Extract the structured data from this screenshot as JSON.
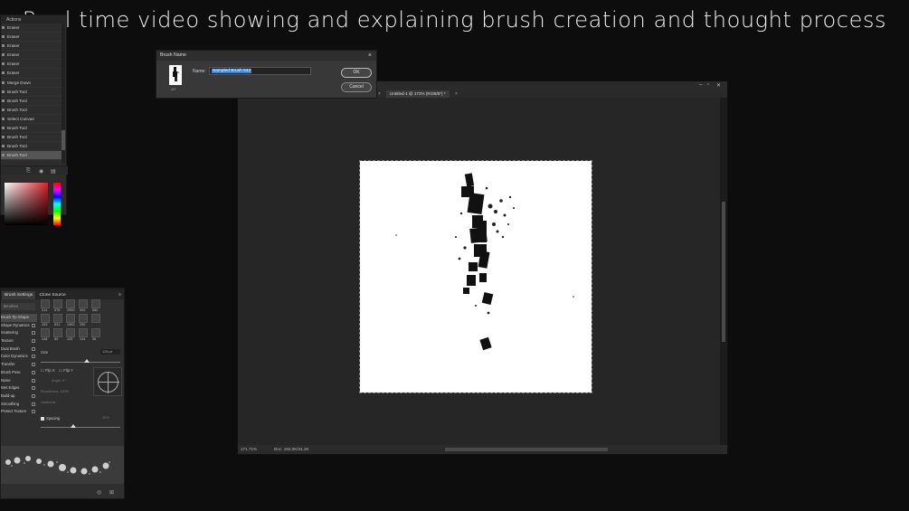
{
  "caption": "Real time video showing and explaining brush creation and thought process",
  "history": {
    "tab_label": "Actions",
    "items": [
      "Eraser",
      "Eraser",
      "Eraser",
      "Eraser",
      "Eraser",
      "Eraser",
      "Merge Down",
      "Brush Tool",
      "Brush Tool",
      "Brush Tool",
      "Select Canvas",
      "Brush Tool",
      "Brush Tool",
      "Brush Tool",
      "Brush Tool"
    ],
    "active_index": 14
  },
  "brush_settings": {
    "tabs": [
      "Brush Settings",
      "Clone Source"
    ],
    "brushes_button": "Brushes",
    "options": [
      "Brush Tip Shape",
      "Shape Dynamics",
      "Scattering",
      "Texture",
      "Dual Brush",
      "Color Dynamics",
      "Transfer",
      "Brush Pose",
      "Noise",
      "Wet Edges",
      "Build-up",
      "Smoothing",
      "Protect Texture"
    ],
    "active_option": 0,
    "tip_numbers_row1": [
      "314",
      "578",
      "2990",
      "900",
      "560"
    ],
    "tip_numbers_row2": [
      "433",
      "831",
      "1983",
      "250",
      ""
    ],
    "tip_numbers_row3": [
      "448",
      "80",
      "125",
      "134",
      "56"
    ],
    "size_label": "Size",
    "size_value": "125 px",
    "flip_x": "Flip X",
    "flip_y": "Flip Y",
    "angle_label": "Angle:",
    "angle_value": "0°",
    "roundness_label": "Roundness:",
    "roundness_value": "100%",
    "hardness_label": "Hardness",
    "spacing_label": "Spacing",
    "spacing_value": "25%"
  },
  "dialog": {
    "title": "Brush Name",
    "name_label": "Name:",
    "name_value": "Sampled Brush 532",
    "ok_label": "OK",
    "cancel_label": "Cancel",
    "thumb_number": "427"
  },
  "document": {
    "tab_title": "Untitled-1 @ 172% (RGB/8*) *",
    "zoom": "171.71%",
    "doc_size": "Doc: 192.0K/31.2K"
  }
}
